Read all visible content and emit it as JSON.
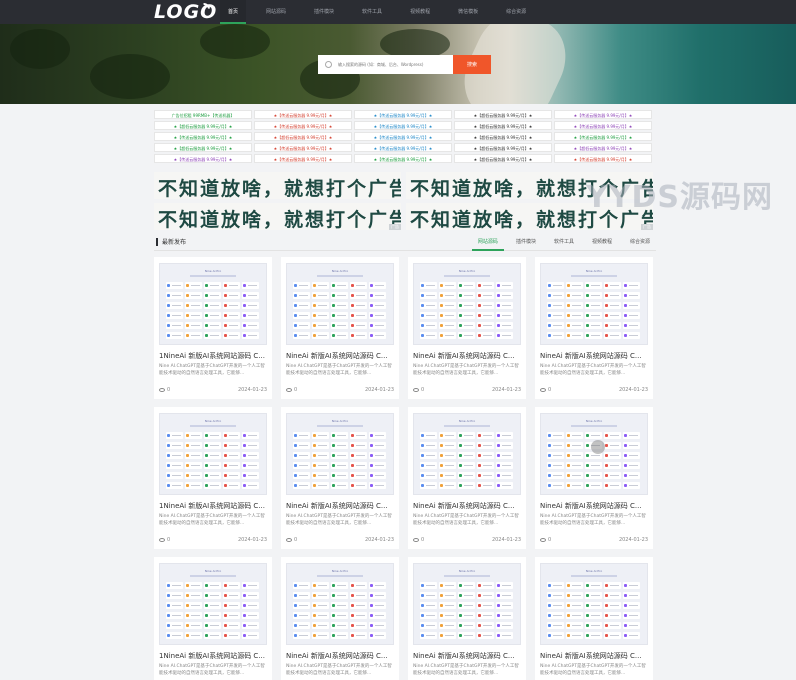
{
  "nav": {
    "logo": "LOGO",
    "items": [
      "首页",
      "网站源码",
      "插件模块",
      "软件工具",
      "视频教程",
      "微信模板",
      "综合资源"
    ]
  },
  "search": {
    "placeholder": "输入搜索的源码 (如：商城、后台、Wordpress)",
    "button": "搜索"
  },
  "ad_links": [
    {
      "text": "广告位招租 99RMB+【传送机器】",
      "color": "#1a9c3d"
    },
    {
      "text": "★【传送云服务器 9.99元/月】★",
      "color": "#d33c2b"
    },
    {
      "text": "★【传送云服务器 9.99元/月】★",
      "color": "#1b86c8"
    },
    {
      "text": "★【超低云服务器 9.99元/月】★",
      "color": "#333333"
    },
    {
      "text": "★【传送云服务器 9.99元/月】★",
      "color": "#8b3fb6"
    },
    {
      "text": "★【超低云服务器 9.99元/月】★",
      "color": "#1a9c3d"
    },
    {
      "text": "★【传送云服务器 9.99元/月】★",
      "color": "#d33c2b"
    },
    {
      "text": "★【传送云服务器 9.99元/月】★",
      "color": "#1b86c8"
    },
    {
      "text": "★【超低云服务器 9.99元/月】★",
      "color": "#333333"
    },
    {
      "text": "★【传送云服务器 9.99元/月】★",
      "color": "#8b3fb6"
    },
    {
      "text": "★【传送云服务器 9.99元/月】★",
      "color": "#1a9c3d"
    },
    {
      "text": "★【超低云服务器 9.99元/月】★",
      "color": "#d33c2b"
    },
    {
      "text": "★【传送云服务器 9.99元/月】★",
      "color": "#1b86c8"
    },
    {
      "text": "★【超低云服务器 9.99元/月】★",
      "color": "#333333"
    },
    {
      "text": "★【传送云服务器 9.99元/月】★",
      "color": "#1a9c3d"
    },
    {
      "text": "★【超低云服务器 9.99元/月】★",
      "color": "#1a9c3d"
    },
    {
      "text": "★【传送云服务器 9.99元/月】★",
      "color": "#d33c2b"
    },
    {
      "text": "★【传送云服务器 9.99元/月】★",
      "color": "#1b86c8"
    },
    {
      "text": "★【超低云服务器 9.99元/月】★",
      "color": "#333333"
    },
    {
      "text": "★【超低云服务器 9.99元/月】★",
      "color": "#8b3fb6"
    },
    {
      "text": "★【传送云服务器 9.99元/月】★",
      "color": "#8b3fb6"
    },
    {
      "text": "★【传送云服务器 9.99元/月】★",
      "color": "#d33c2b"
    },
    {
      "text": "★【传送云服务器 9.99元/月】★",
      "color": "#1a9c3d"
    },
    {
      "text": "★【超低云服务器 9.99元/月】★",
      "color": "#333333"
    },
    {
      "text": "★【传送云服务器 9.99元/月】★",
      "color": "#d33c2b"
    }
  ],
  "banners": {
    "text": "不知道放啥，就想打个广告",
    "tag": "广告"
  },
  "watermark": "YYDS源码网",
  "section": {
    "title": "最新发布",
    "tabs": [
      "网站源码",
      "插件模块",
      "软件工具",
      "视频教程",
      "综合资源"
    ]
  },
  "thumb": {
    "title": "Nine Ai Pro",
    "tile_colors": [
      "#5b8def",
      "#f0a13a",
      "#2ea35b",
      "#e5534b",
      "#8b5cf6"
    ]
  },
  "cards": [
    {
      "title": "1NineAi 新版AI系统网站源码 C...",
      "desc": "Nine AI.ChatGPT是基于ChatGPT开发的一个人工智能技术驱动的自然语言处理工具，它能够...",
      "views": "0",
      "date": "2024-01-23"
    },
    {
      "title": "NineAi 新版AI系统网站源码 C...",
      "desc": "Nine AI.ChatGPT是基于ChatGPT开发的一个人工智能技术驱动的自然语言处理工具，它能够...",
      "views": "0",
      "date": "2024-01-23"
    },
    {
      "title": "NineAi 新版AI系统网站源码 C...",
      "desc": "Nine AI.ChatGPT是基于ChatGPT开发的一个人工智能技术驱动的自然语言处理工具，它能够...",
      "views": "0",
      "date": "2024-01-23"
    },
    {
      "title": "NineAi 新版AI系统网站源码 C...",
      "desc": "Nine AI.ChatGPT是基于ChatGPT开发的一个人工智能技术驱动的自然语言处理工具，它能够...",
      "views": "0",
      "date": "2024-01-23"
    },
    {
      "title": "1NineAi 新版AI系统网站源码 C...",
      "desc": "Nine AI.ChatGPT是基于ChatGPT开发的一个人工智能技术驱动的自然语言处理工具，它能够...",
      "views": "0",
      "date": "2024-01-23"
    },
    {
      "title": "NineAi 新版AI系统网站源码 C...",
      "desc": "Nine AI.ChatGPT是基于ChatGPT开发的一个人工智能技术驱动的自然语言处理工具，它能够...",
      "views": "0",
      "date": "2024-01-23"
    },
    {
      "title": "NineAi 新版AI系统网站源码 C...",
      "desc": "Nine AI.ChatGPT是基于ChatGPT开发的一个人工智能技术驱动的自然语言处理工具，它能够...",
      "views": "0",
      "date": "2024-01-23"
    },
    {
      "title": "NineAi 新版AI系统网站源码 C...",
      "desc": "Nine AI.ChatGPT是基于ChatGPT开发的一个人工智能技术驱动的自然语言处理工具，它能够...",
      "views": "0",
      "date": "2024-01-23"
    },
    {
      "title": "1NineAi 新版AI系统网站源码 C...",
      "desc": "Nine AI.ChatGPT是基于ChatGPT开发的一个人工智能技术驱动的自然语言处理工具，它能够...",
      "views": "0",
      "date": "2024-01-23"
    },
    {
      "title": "NineAi 新版AI系统网站源码 C...",
      "desc": "Nine AI.ChatGPT是基于ChatGPT开发的一个人工智能技术驱动的自然语言处理工具，它能够...",
      "views": "0",
      "date": "2024-01-23"
    },
    {
      "title": "NineAi 新版AI系统网站源码 C...",
      "desc": "Nine AI.ChatGPT是基于ChatGPT开发的一个人工智能技术驱动的自然语言处理工具，它能够...",
      "views": "0",
      "date": "2024-01-23"
    },
    {
      "title": "NineAi 新版AI系统网站源码 C...",
      "desc": "Nine AI.ChatGPT是基于ChatGPT开发的一个人工智能技术驱动的自然语言处理工具，它能够...",
      "views": "0",
      "date": "2024-01-23"
    }
  ],
  "colors": {
    "nav_bg": "#2b2d33",
    "accent_green": "#2ea35b",
    "search_button": "#f0562a"
  }
}
